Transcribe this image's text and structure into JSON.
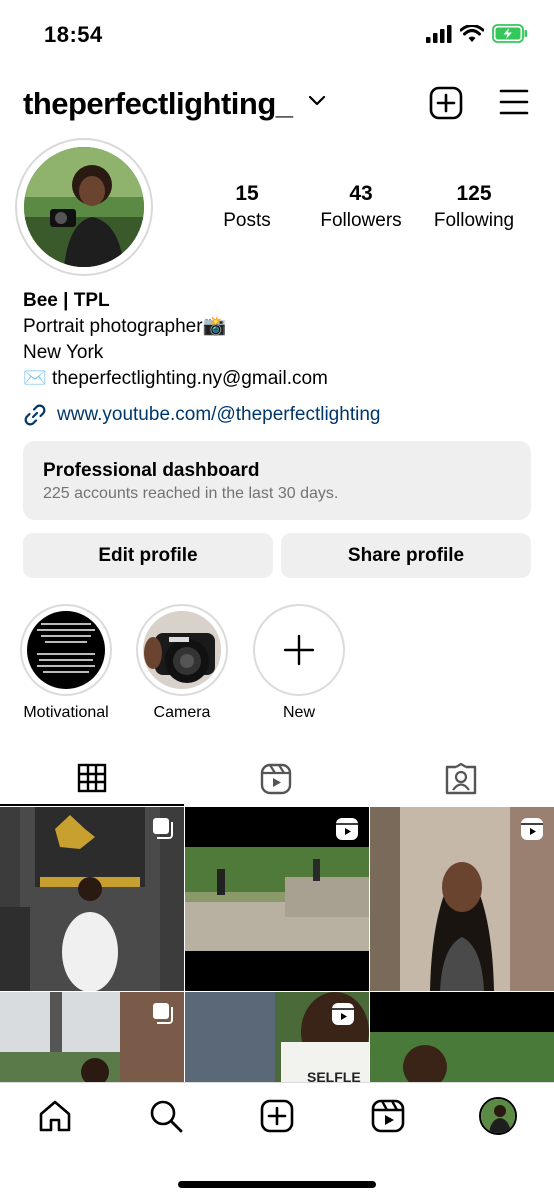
{
  "status": {
    "time": "18:54"
  },
  "header": {
    "username": "theperfectlighting_"
  },
  "stats": [
    {
      "value": "15",
      "label": "Posts"
    },
    {
      "value": "43",
      "label": "Followers"
    },
    {
      "value": "125",
      "label": "Following"
    }
  ],
  "bio": {
    "name": "Bee | TPL",
    "line1": "Portrait photographer📸",
    "line2": "New York",
    "email_icon": "✉️",
    "email": "theperfectlighting.ny@gmail.com",
    "link": "www.youtube.com/@theperfectlighting"
  },
  "dashboard": {
    "title": "Professional dashboard",
    "subtitle": "225 accounts reached in the last 30 days."
  },
  "buttons": {
    "edit": "Edit profile",
    "share": "Share profile"
  },
  "highlights": [
    {
      "label": "Motivational"
    },
    {
      "label": "Camera"
    },
    {
      "label": "New"
    }
  ],
  "tabs": [
    "grid-icon",
    "reels-icon",
    "tagged-icon"
  ],
  "colors": {
    "link": "#00376b",
    "muted": "#737373",
    "button_bg": "#efefef",
    "battery": "#34c759"
  }
}
